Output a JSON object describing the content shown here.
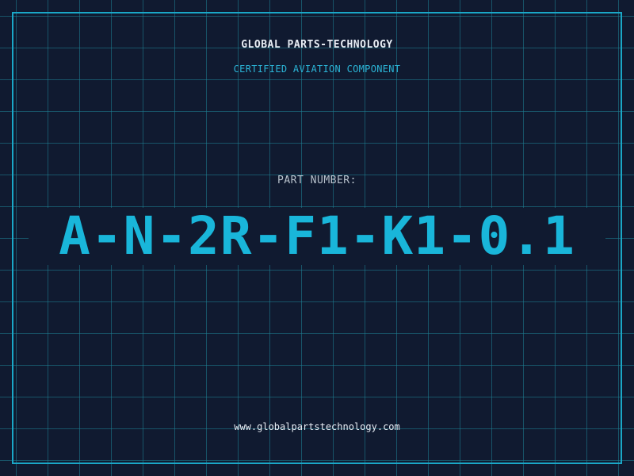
{
  "brand": {
    "name": "GLOBAL PARTS-TECHNOLOGY",
    "tagline": "CERTIFIED AVIATION COMPONENT"
  },
  "part": {
    "label": "PART NUMBER:",
    "number": "A-N-2R-F1-K1-0.1"
  },
  "footer": {
    "website": "www.globalpartstechnology.com"
  },
  "colors": {
    "background": "#101a30",
    "grid": "#1e8296",
    "frame": "#1aa7c7",
    "accent": "#19b6da",
    "text_primary": "#e8eef5",
    "text_secondary": "#b8c2cc"
  }
}
